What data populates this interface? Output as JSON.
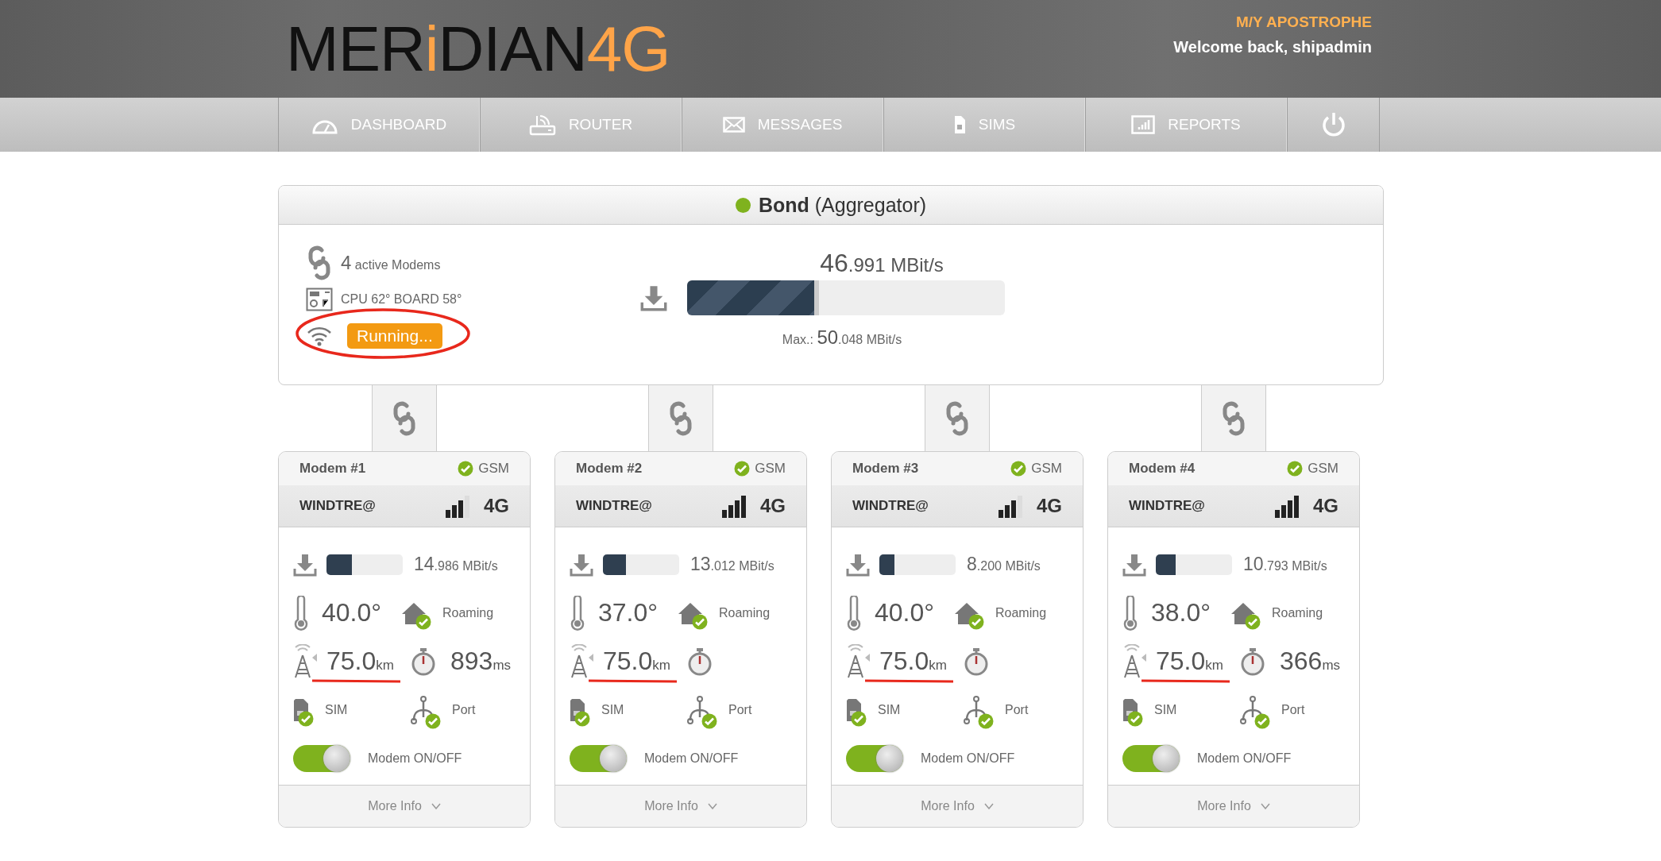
{
  "header": {
    "logo": [
      {
        "text": "MER",
        "accent": false
      },
      {
        "text": "i",
        "accent": true
      },
      {
        "text": "DIAN",
        "accent": false
      },
      {
        "text": "4G",
        "accent": true
      }
    ],
    "vessel": "M/Y APOSTROPHE",
    "welcome": "Welcome back, shipadmin"
  },
  "nav": {
    "items": [
      {
        "label": "DASHBOARD",
        "kind": "gauge",
        "selected": false
      },
      {
        "label": "ROUTER",
        "kind": "router",
        "selected": false
      },
      {
        "label": "MESSAGES",
        "kind": "envelope",
        "selected": false
      },
      {
        "label": "SIMS",
        "kind": "sim",
        "selected": false
      },
      {
        "label": "REPORTS",
        "kind": "chart",
        "selected": false
      },
      {
        "kind": "power",
        "selected": false
      }
    ]
  },
  "bond": {
    "color": "#7fb21e",
    "title": "Bond",
    "subtitle": "(Aggregator)",
    "active_count": "4",
    "active_label": "active Modems",
    "temperatures": "CPU 62° BOARD 58°",
    "status": "Running...",
    "status_circled": true,
    "speed_whole": "46",
    "speed_rest": ".991 MBit/s",
    "level": 0.4,
    "max_label": "Max.:",
    "max_whole": "50",
    "max_rest": ".048 MBit/s"
  },
  "modems": [
    {
      "name": "Modem #1",
      "network": "GSM",
      "operator": "WINDTRE@",
      "signal_full": false,
      "tech": "4G",
      "speed_whole": "14",
      "speed_rest": ".986 MBit/s",
      "level": 0.33,
      "temperature": "40.0°",
      "roaming": "Roaming",
      "distance": "75.0",
      "distance_unit": "km",
      "distance_underlined": true,
      "latency": "893",
      "latency_unit": "ms",
      "sim": "SIM",
      "port": "Port",
      "on": true,
      "toggle_label": "Modem ON/OFF",
      "more": "More Info"
    },
    {
      "name": "Modem #2",
      "network": "GSM",
      "operator": "WINDTRE@",
      "signal_full": true,
      "tech": "4G",
      "speed_whole": "13",
      "speed_rest": ".012 MBit/s",
      "level": 0.3,
      "temperature": "37.0°",
      "roaming": "Roaming",
      "distance": "75.0",
      "distance_unit": "km",
      "distance_underlined": true,
      "sim": "SIM",
      "port": "Port",
      "on": true,
      "toggle_label": "Modem ON/OFF",
      "more": "More Info"
    },
    {
      "name": "Modem #3",
      "network": "GSM",
      "operator": "WINDTRE@",
      "signal_full": false,
      "tech": "4G",
      "speed_whole": "8",
      "speed_rest": ".200 MBit/s",
      "level": 0.2,
      "temperature": "40.0°",
      "roaming": "Roaming",
      "distance": "75.0",
      "distance_unit": "km",
      "distance_underlined": true,
      "sim": "SIM",
      "port": "Port",
      "on": true,
      "toggle_label": "Modem ON/OFF",
      "more": "More Info"
    },
    {
      "name": "Modem #4",
      "network": "GSM",
      "operator": "WINDTRE@",
      "signal_full": true,
      "tech": "4G",
      "speed_whole": "10",
      "speed_rest": ".793 MBit/s",
      "level": 0.26,
      "temperature": "38.0°",
      "roaming": "Roaming",
      "distance": "75.0",
      "distance_unit": "km",
      "distance_underlined": true,
      "latency": "366",
      "latency_unit": "ms",
      "sim": "SIM",
      "port": "Port",
      "on": true,
      "toggle_label": "Modem ON/OFF",
      "more": "More Info"
    }
  ]
}
